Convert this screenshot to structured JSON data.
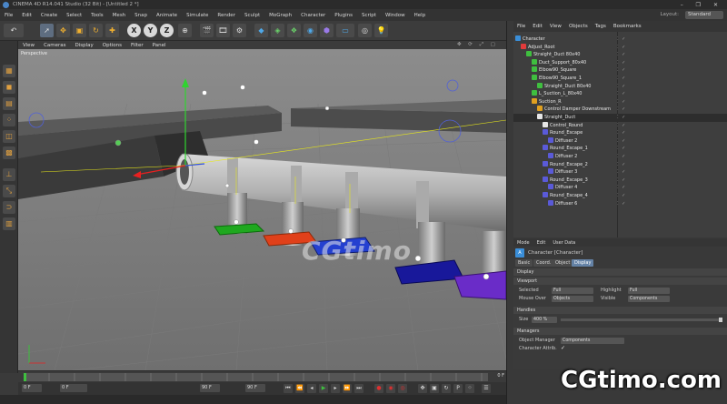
{
  "titlebar": {
    "title": "CINEMA 4D R14.041 Studio (32 Bit) - [Untitled 2 *]"
  },
  "menubar": {
    "items": [
      "File",
      "Edit",
      "Create",
      "Select",
      "Tools",
      "Mesh",
      "Snap",
      "Animate",
      "Simulate",
      "Render",
      "Sculpt",
      "MoGraph",
      "Character",
      "Plugins",
      "Script",
      "Window",
      "Help"
    ],
    "layout_label": "Layout:",
    "layout_value": "Standard"
  },
  "toolbar": {
    "x": "X",
    "y": "Y",
    "z": "Z"
  },
  "viewport": {
    "menu": [
      "View",
      "Cameras",
      "Display",
      "Options",
      "Filter",
      "Panel"
    ],
    "label": "Perspective"
  },
  "timeline": {
    "ticks": [
      "0",
      "5",
      "10",
      "15",
      "20",
      "25",
      "30",
      "35",
      "40",
      "45",
      "50",
      "55",
      "60",
      "65",
      "70",
      "75",
      "80",
      "85",
      "90"
    ],
    "frame": "0 F",
    "start_field": "0 F",
    "current_field": "0 F",
    "end_field": "90 F",
    "end_field2": "90 F"
  },
  "object_manager": {
    "menu": [
      "File",
      "Edit",
      "View",
      "Objects",
      "Tags",
      "Bookmarks"
    ],
    "rows": [
      {
        "name": "Character",
        "indent": 0,
        "color": "#3a8ed8"
      },
      {
        "name": "Adjust_Root",
        "indent": 1,
        "color": "#e23b3b"
      },
      {
        "name": "Straight_Duct 80x40",
        "indent": 2,
        "color": "#3fbf3f"
      },
      {
        "name": "Duct_Support_80x40",
        "indent": 3,
        "color": "#3fbf3f"
      },
      {
        "name": "Elbow90_Square",
        "indent": 3,
        "color": "#3fbf3f"
      },
      {
        "name": "Elbow90_Square_1",
        "indent": 3,
        "color": "#3fbf3f"
      },
      {
        "name": "Straight_Duct 80x40",
        "indent": 4,
        "color": "#3fbf3f"
      },
      {
        "name": "L_Suction_L_80x40",
        "indent": 3,
        "color": "#3fbf3f"
      },
      {
        "name": "Suction_R",
        "indent": 3,
        "color": "#e0a020"
      },
      {
        "name": "Control Damper Downstream",
        "indent": 4,
        "color": "#e0a020"
      },
      {
        "name": "Straight_Duct",
        "indent": 4,
        "color": "#e6e6e6"
      },
      {
        "name": "Control_Round",
        "indent": 5,
        "color": "#e6e6e6"
      },
      {
        "name": "Round_Escape",
        "indent": 5,
        "color": "#5a5ad8"
      },
      {
        "name": "Diffuser 2",
        "indent": 6,
        "color": "#5a5ad8"
      },
      {
        "name": "Round_Escape_1",
        "indent": 5,
        "color": "#5a5ad8"
      },
      {
        "name": "Diffuser 2",
        "indent": 6,
        "color": "#5a5ad8"
      },
      {
        "name": "Round_Escape_2",
        "indent": 5,
        "color": "#5a5ad8"
      },
      {
        "name": "Diffuser 3",
        "indent": 6,
        "color": "#5a5ad8"
      },
      {
        "name": "Round_Escape_3",
        "indent": 5,
        "color": "#5a5ad8"
      },
      {
        "name": "Diffuser 4",
        "indent": 6,
        "color": "#5a5ad8"
      },
      {
        "name": "Round_Escape_4",
        "indent": 5,
        "color": "#5a5ad8"
      },
      {
        "name": "Diffuser 6",
        "indent": 6,
        "color": "#5a5ad8"
      }
    ]
  },
  "attribute_manager": {
    "menu": [
      "Mode",
      "Edit",
      "User Data"
    ],
    "title": "Character [Character]",
    "tabs": [
      "Basic",
      "Coord.",
      "Object",
      "Display"
    ],
    "active_tab": "Display",
    "section_display": "Display",
    "viewport_section": "Viewport",
    "selected_label": "Selected",
    "selected_value": "Full",
    "highlight_label": "Highlight",
    "highlight_value": "Full",
    "mouseover_label": "Mouse Over",
    "mouseover_value": "Objects",
    "visible_label": "Visible",
    "visible_value": "Components",
    "handles_section": "Handles",
    "size_label": "Size",
    "size_value": "400 %",
    "manager_section": "Managers",
    "objman_label": "Object Manager",
    "objman_value": "Components",
    "charattr_label": "Character Attrib.",
    "charattr_check": "✓"
  },
  "watermark": {
    "center": "CGtimo",
    "corner": "CGtimo.com"
  }
}
